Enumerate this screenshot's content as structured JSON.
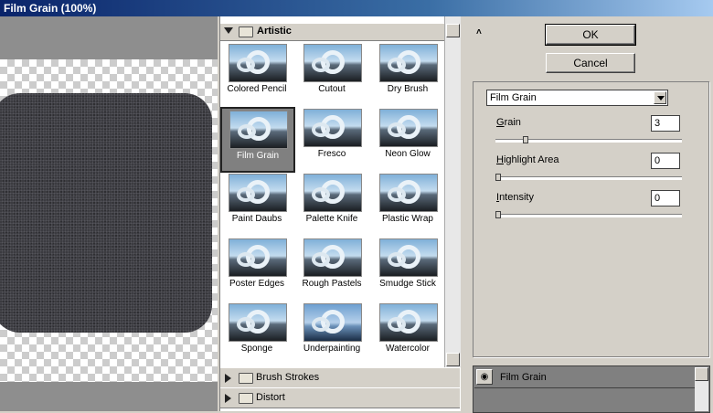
{
  "window": {
    "title": "Film Grain (100%)"
  },
  "gallery": {
    "open_category": "Artistic",
    "filters": [
      "Colored Pencil",
      "Cutout",
      "Dry Brush",
      "Film Grain",
      "Fresco",
      "Neon Glow",
      "Paint Daubs",
      "Palette Knife",
      "Plastic Wrap",
      "Poster Edges",
      "Rough Pastels",
      "Smudge Stick",
      "Sponge",
      "Underpainting",
      "Watercolor"
    ],
    "selected_filter": "Film Grain",
    "collapsed_categories": [
      "Brush Strokes",
      "Distort"
    ]
  },
  "buttons": {
    "ok": "OK",
    "cancel": "Cancel"
  },
  "settings": {
    "filter_select": "Film Grain",
    "grain": {
      "label_key": "G",
      "label_rest": "rain",
      "value": "3",
      "level": 0.15
    },
    "highlight_area": {
      "label_key": "H",
      "label_rest": "ighlight Area",
      "value": "0",
      "level": 0
    },
    "intensity": {
      "label_key": "I",
      "label_rest": "ntensity",
      "value": "0",
      "level": 0
    }
  },
  "layers": {
    "items": [
      "Film Grain"
    ]
  },
  "icons": {
    "collapse": "double-chevron-up-icon",
    "eye": "eye-icon",
    "folder": "folder-icon"
  }
}
